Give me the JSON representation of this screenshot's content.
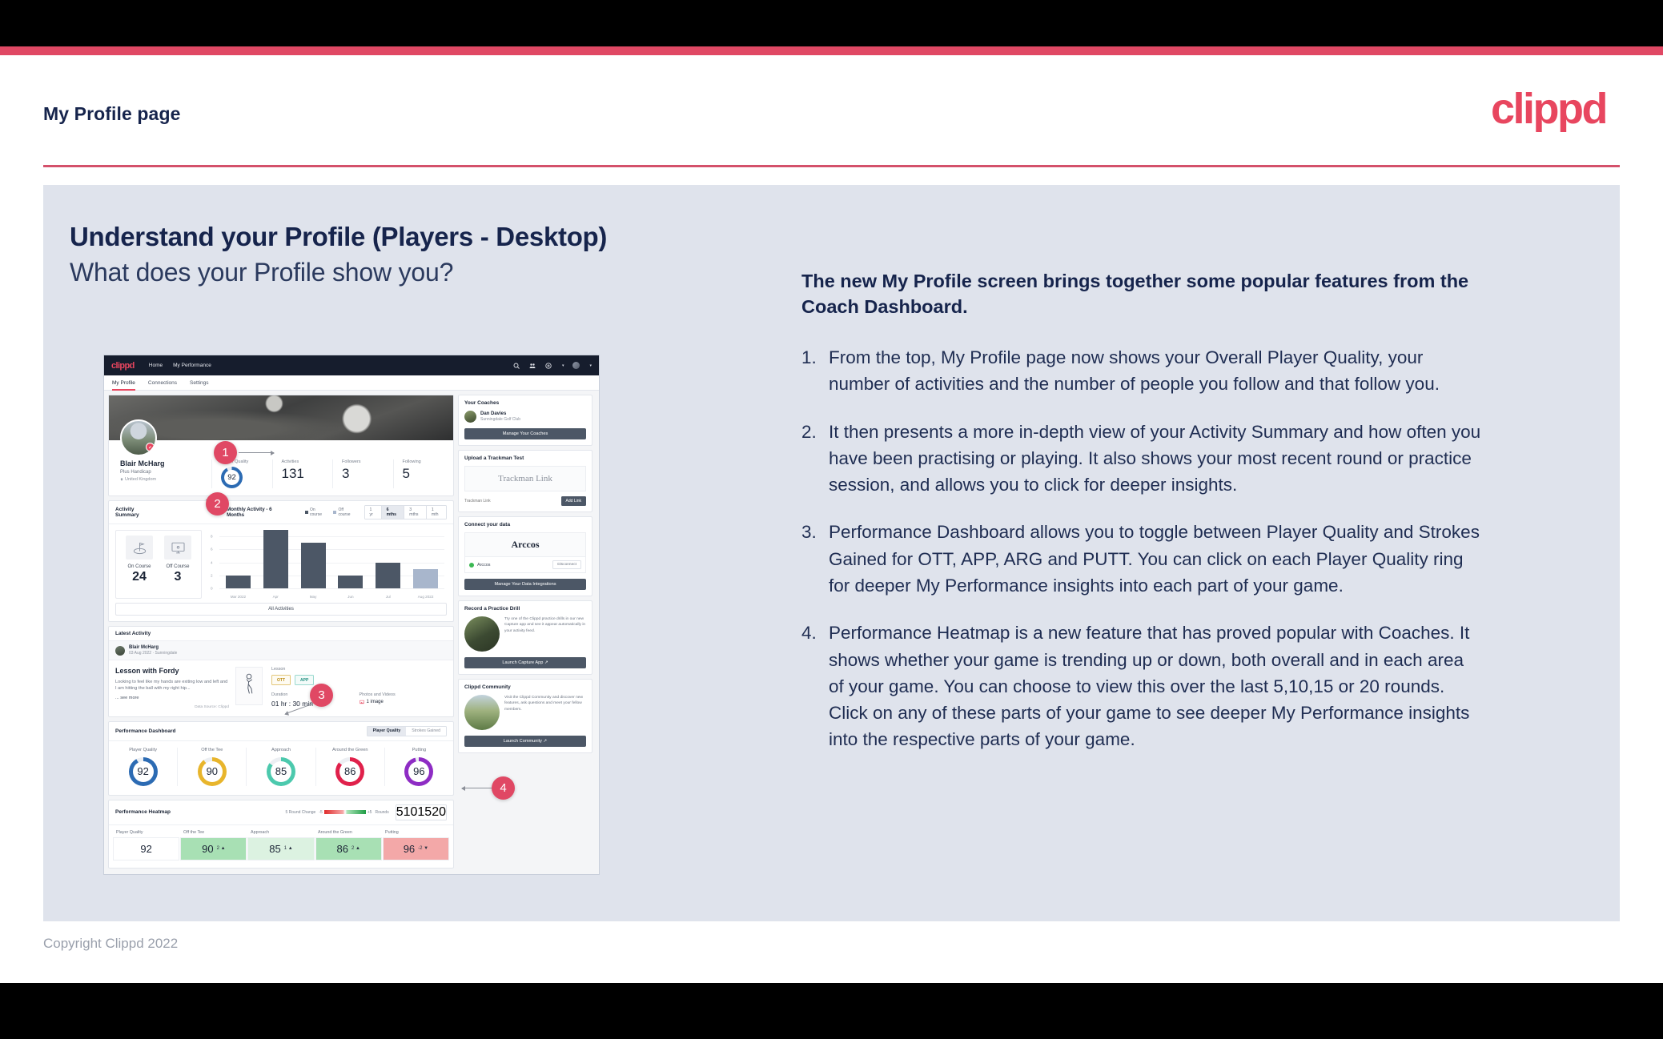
{
  "slide": {
    "header_title": "My Profile page",
    "logo": "clippd",
    "heading_main": "Understand your Profile (Players - Desktop)",
    "heading_sub": "What does your Profile show you?",
    "copyright": "Copyright Clippd 2022",
    "accent_color": "#e04864",
    "panel_color": "#dfe3ec",
    "navy": "#16244c"
  },
  "explainer": {
    "lead": "The new My Profile screen brings together some popular features from the Coach Dashboard.",
    "items": [
      {
        "num": "1.",
        "text": "From the top, My Profile page now shows your Overall Player Quality, your number of activities and the number of people you follow and that follow you."
      },
      {
        "num": "2.",
        "text": "It then presents a more in-depth view of your Activity Summary and how often you have been practising or playing. It also shows your most recent round or practice session, and allows you to click for deeper insights."
      },
      {
        "num": "3.",
        "text": "Performance Dashboard allows you to toggle between Player Quality and Strokes Gained for OTT, APP, ARG and PUTT. You can click on each Player Quality ring for deeper My Performance insights into each part of your game."
      },
      {
        "num": "4.",
        "text": "Performance Heatmap is a new feature that has proved popular with Coaches. It shows whether your game is trending up or down, both overall and in each area of your game. You can choose to view this over the last 5,10,15 or 20 rounds. Click on any of these parts of your game to see deeper My Performance insights into the respective parts of your game."
      }
    ]
  },
  "callouts": [
    {
      "label": "1"
    },
    {
      "label": "2"
    },
    {
      "label": "3"
    },
    {
      "label": "4"
    }
  ],
  "app": {
    "logo": "clippd",
    "nav_links": [
      "Home",
      "My Performance"
    ],
    "nav_icons": [
      "search-icon",
      "community-icon",
      "add-circle-icon",
      "avatar-icon"
    ],
    "tabs": [
      {
        "label": "My Profile",
        "active": true
      },
      {
        "label": "Connections",
        "active": false
      },
      {
        "label": "Settings",
        "active": false
      }
    ],
    "profile": {
      "name": "Blair McHarg",
      "handicap": "Plus Handicap",
      "location": "United Kingdom",
      "stats": [
        {
          "label": "Player Quality",
          "value": "92",
          "type": "ring",
          "color": "#2c6bb3"
        },
        {
          "label": "Activities",
          "value": "131",
          "type": "number"
        },
        {
          "label": "Followers",
          "value": "3",
          "type": "number"
        },
        {
          "label": "Following",
          "value": "5",
          "type": "number"
        }
      ]
    },
    "activity_summary": {
      "title": "Activity Summary",
      "chart_title": "Monthly Activity - 6 Months",
      "legend": [
        "On course",
        "Off course"
      ],
      "ranges": [
        {
          "label": "1 yr",
          "on": false
        },
        {
          "label": "6 mths",
          "on": true
        },
        {
          "label": "3 mths",
          "on": false
        },
        {
          "label": "1 mth",
          "on": false
        }
      ],
      "tiles": [
        {
          "label": "On Course",
          "value": "24",
          "icon": "flag-green-icon"
        },
        {
          "label": "Off Course",
          "value": "3",
          "icon": "monitor-icon"
        }
      ],
      "all_button": "All Activities"
    },
    "latest_activity": {
      "title": "Latest Activity",
      "user": "Blair McHarg",
      "meta": "03 Aug 2022 · Sunningdale",
      "heading": "Lesson with Fordy",
      "body": "Looking to feel like my hands are exiting low and left and I am hitting the ball with my right hip...",
      "see_more": "... see more",
      "source": "Data Source: Clippd",
      "type_label": "Lesson",
      "tags": [
        "OTT",
        "APP"
      ],
      "duration_label": "Duration",
      "duration_value": "01 hr : 30 min",
      "photos_label": "Photos and Videos",
      "photos_value": "1 image"
    },
    "performance_dashboard": {
      "title": "Performance Dashboard",
      "toggle": [
        {
          "label": "Player Quality",
          "on": true
        },
        {
          "label": "Strokes Gained",
          "on": false
        }
      ],
      "rings": [
        {
          "label": "Player Quality",
          "value": 92,
          "color": "#2c6bb3"
        },
        {
          "label": "Off the Tee",
          "value": 90,
          "color": "#e8b52c"
        },
        {
          "label": "Approach",
          "value": 85,
          "color": "#4cc9ad"
        },
        {
          "label": "Around the Green",
          "value": 86,
          "color": "#e0214b"
        },
        {
          "label": "Putting",
          "value": 96,
          "color": "#8e2cc4"
        }
      ]
    },
    "heatmap": {
      "title": "Performance Heatmap",
      "scale_label": "5 Round Change",
      "scale_min": "-5",
      "scale_max": "+5",
      "rounds_label": "Rounds",
      "rounds": [
        {
          "label": "5",
          "on": true
        },
        {
          "label": "10",
          "on": false
        },
        {
          "label": "15",
          "on": false
        },
        {
          "label": "20",
          "on": false
        }
      ],
      "cells": [
        {
          "label": "Player Quality",
          "value": "92",
          "delta": "",
          "bg": "#ffffff"
        },
        {
          "label": "Off the Tee",
          "value": "90",
          "delta": "2 ▲",
          "bg": "#a8e0b4"
        },
        {
          "label": "Approach",
          "value": "85",
          "delta": "1 ▲",
          "bg": "#dcf2e1"
        },
        {
          "label": "Around the Green",
          "value": "86",
          "delta": "2 ▲",
          "bg": "#a8e0b4"
        },
        {
          "label": "Putting",
          "value": "96",
          "delta": "-2 ▼",
          "bg": "#f3a8a8"
        }
      ]
    },
    "sidebar": {
      "coaches": {
        "title": "Your Coaches",
        "coach_name": "Dan Davies",
        "coach_club": "Sunningdale Golf Club",
        "button": "Manage Your Coaches"
      },
      "trackman": {
        "title": "Upload a Trackman Test",
        "brand": "Trackman Link",
        "placeholder": "Trackman Link",
        "button": "Add Link"
      },
      "connect": {
        "title": "Connect your data",
        "brand": "Arccos",
        "status_name": "Arccos",
        "disconnect": "Disconnect",
        "button": "Manage Your Data Integrations"
      },
      "practice": {
        "title": "Record a Practice Drill",
        "body": "Try one of the Clippd practice drills in our new Capture app and see it appear automatically in your activity feed.",
        "button": "Launch Capture App"
      },
      "community": {
        "title": "Clippd Community",
        "body": "Visit the Clippd Community and discover new features, ask questions and meet your fellow members.",
        "button": "Launch Community"
      }
    }
  },
  "chart_data": {
    "type": "bar",
    "title": "Monthly Activity - 6 Months",
    "categories": [
      "Mar 2022",
      "Apr",
      "May",
      "Jun",
      "Jul",
      "Aug 2022"
    ],
    "values": [
      2,
      9,
      7,
      2,
      4,
      3
    ],
    "series": [
      {
        "name": "On course",
        "values": [
          2,
          9,
          7,
          2,
          4,
          0
        ],
        "color": "#4c5766"
      },
      {
        "name": "Off course",
        "values": [
          0,
          0,
          0,
          0,
          0,
          3
        ],
        "color": "#a8b6cc"
      }
    ],
    "xlabel": "",
    "ylabel": "",
    "ylim": [
      0,
      9
    ],
    "yticks": [
      0,
      2,
      4,
      6,
      8
    ],
    "grid": true,
    "legend_position": "top"
  }
}
